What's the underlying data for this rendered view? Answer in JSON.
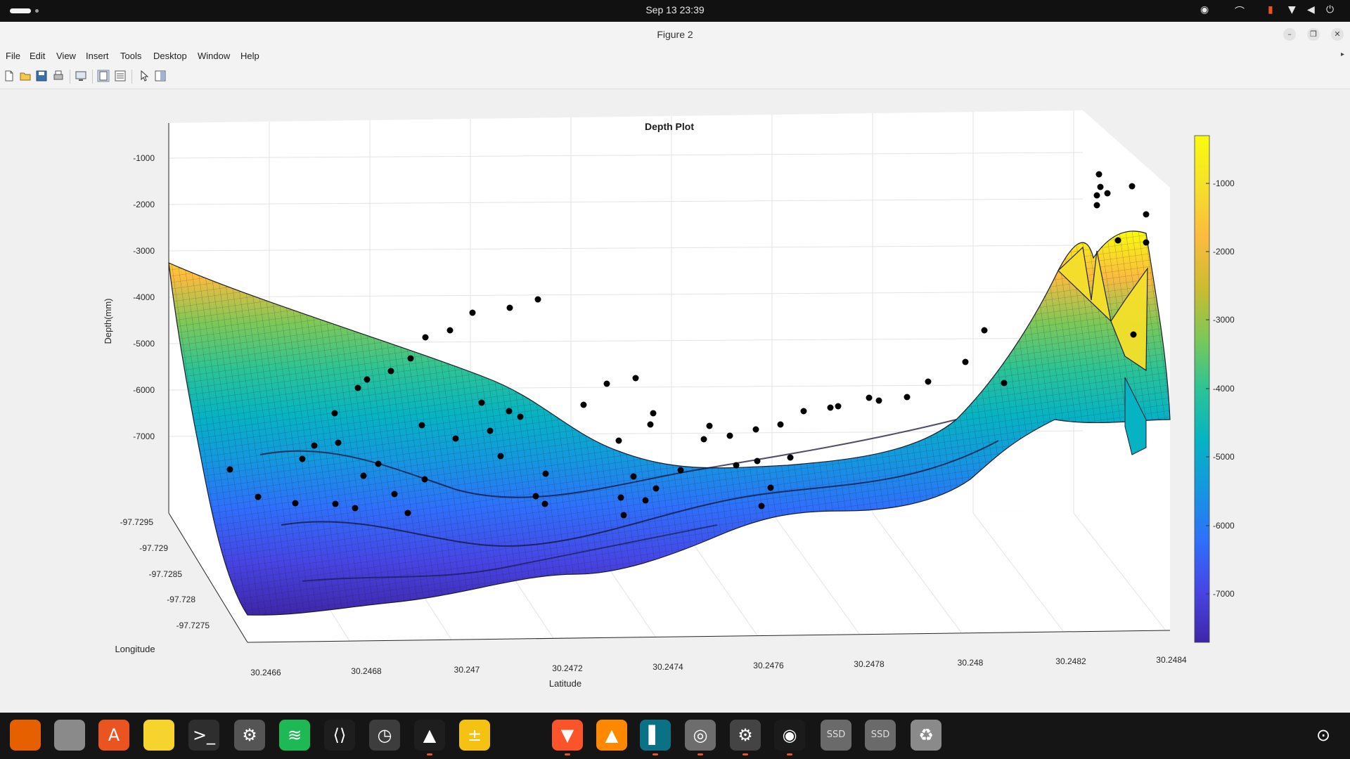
{
  "system_bar": {
    "datetime": "Sep 13  23:39",
    "tray_icons": [
      "chrome-remote-icon",
      "hotspot-icon",
      "mic-icon",
      "wifi-icon",
      "volume-icon",
      "power-icon"
    ]
  },
  "window": {
    "title": "Figure 2",
    "controls": [
      "minimize",
      "maximize",
      "close"
    ]
  },
  "menu": {
    "items": [
      {
        "label": "File"
      },
      {
        "label": "Edit"
      },
      {
        "label": "View"
      },
      {
        "label": "Insert"
      },
      {
        "label": "Tools"
      },
      {
        "label": "Desktop"
      },
      {
        "label": "Window"
      },
      {
        "label": "Help"
      }
    ]
  },
  "toolbar": {
    "buttons": [
      "new-figure",
      "open-file",
      "save-figure",
      "print-figure",
      "link-plot",
      "dock-figure",
      "property-inspector",
      "edit-plot",
      "plot-browser"
    ]
  },
  "plot": {
    "title": "Depth Plot",
    "zlabel": "Depth(mm)",
    "xlabel": "Latitude",
    "ylabel": "Longitude",
    "z_ticks": [
      "-1000",
      "-2000",
      "-3000",
      "-4000",
      "-5000",
      "-6000",
      "-7000"
    ],
    "x_ticks": [
      "30.2466",
      "30.2468",
      "30.247",
      "30.2472",
      "30.2474",
      "30.2476",
      "30.2478",
      "30.248",
      "30.2482",
      "30.2484"
    ],
    "y_ticks": [
      "-97.7295",
      "-97.729",
      "-97.7285",
      "-97.728",
      "-97.7275"
    ],
    "colorbar_ticks": [
      "-1000",
      "-2000",
      "-3000",
      "-4000",
      "-5000",
      "-6000",
      "-7000"
    ],
    "colormap": [
      "#3e26a8",
      "#4745e4",
      "#2f6ffb",
      "#1596e0",
      "#06b3c3",
      "#2cc395",
      "#7cc858",
      "#cdbb30",
      "#fbbb3e",
      "#f5e02a",
      "#f9fb0e"
    ]
  },
  "chart_data": {
    "type": "surface",
    "title": "Depth Plot",
    "xlabel": "Latitude",
    "ylabel": "Longitude",
    "zlabel": "Depth(mm)",
    "xlim": [
      30.2465,
      30.2485
    ],
    "ylim": [
      -97.7297,
      -97.7274
    ],
    "zlim": [
      -7800,
      -500
    ],
    "colorbar_range": [
      -7600,
      -300
    ],
    "surface_profile": [
      {
        "latitude": 30.2465,
        "depth": -3200
      },
      {
        "latitude": 30.2466,
        "depth": -6600
      },
      {
        "latitude": 30.2468,
        "depth": -6900
      },
      {
        "latitude": 30.247,
        "depth": -6700
      },
      {
        "latitude": 30.2472,
        "depth": -5900
      },
      {
        "latitude": 30.2474,
        "depth": -6300
      },
      {
        "latitude": 30.2476,
        "depth": -6500
      },
      {
        "latitude": 30.2478,
        "depth": -5600
      },
      {
        "latitude": 30.248,
        "depth": -3900
      },
      {
        "latitude": 30.2482,
        "depth": -1600
      },
      {
        "latitude": 30.2483,
        "depth": -800
      },
      {
        "latitude": 30.2484,
        "depth": -2600
      }
    ],
    "grid": true,
    "colorbar": "right"
  },
  "dock": {
    "apps": [
      {
        "name": "firefox",
        "color": "#e66000",
        "glyph": "",
        "running": false
      },
      {
        "name": "files",
        "color": "#8a8a8a",
        "glyph": "",
        "running": false
      },
      {
        "name": "app-center",
        "color": "#e95420",
        "glyph": "A",
        "running": false
      },
      {
        "name": "text-editor",
        "color": "#f6d32d",
        "glyph": "",
        "running": false
      },
      {
        "name": "terminal",
        "color": "#2e2e2e",
        "glyph": ">_",
        "running": false
      },
      {
        "name": "settings",
        "color": "#555555",
        "glyph": "⚙",
        "running": false
      },
      {
        "name": "spotify",
        "color": "#1db954",
        "glyph": "≋",
        "running": false
      },
      {
        "name": "vscode",
        "color": "#1e1e1e",
        "glyph": "⟨⟩",
        "running": false
      },
      {
        "name": "clock",
        "color": "#3d3d3d",
        "glyph": "◷",
        "running": false
      },
      {
        "name": "matlab",
        "color": "#1e1e1e",
        "glyph": "▲",
        "running": true
      },
      {
        "name": "calculator",
        "color": "#f5c211",
        "glyph": "±",
        "running": false
      },
      {
        "name": "brave",
        "color": "#fb542b",
        "glyph": "▼",
        "running": true
      },
      {
        "name": "vlc",
        "color": "#ff8800",
        "glyph": "▲",
        "running": false
      },
      {
        "name": "pycharm",
        "color": "#0b7285",
        "glyph": "▌",
        "running": true
      },
      {
        "name": "disk-utility",
        "color": "#6d6d6d",
        "glyph": "◎",
        "running": true
      },
      {
        "name": "system-settings",
        "color": "#444444",
        "glyph": "⚙",
        "running": true
      },
      {
        "name": "obs-studio",
        "color": "#1b1b1b",
        "glyph": "◉",
        "running": true
      },
      {
        "name": "ssd-drive",
        "color": "#6a6a6a",
        "glyph": "SSD",
        "running": false
      },
      {
        "name": "ssd-drive-2",
        "color": "#6a6a6a",
        "glyph": "SSD",
        "running": false
      },
      {
        "name": "trash",
        "color": "#8a8a8a",
        "glyph": "♻",
        "running": false
      },
      {
        "name": "show-apps",
        "color": "#151515",
        "glyph": "⊙",
        "running": false
      }
    ]
  }
}
